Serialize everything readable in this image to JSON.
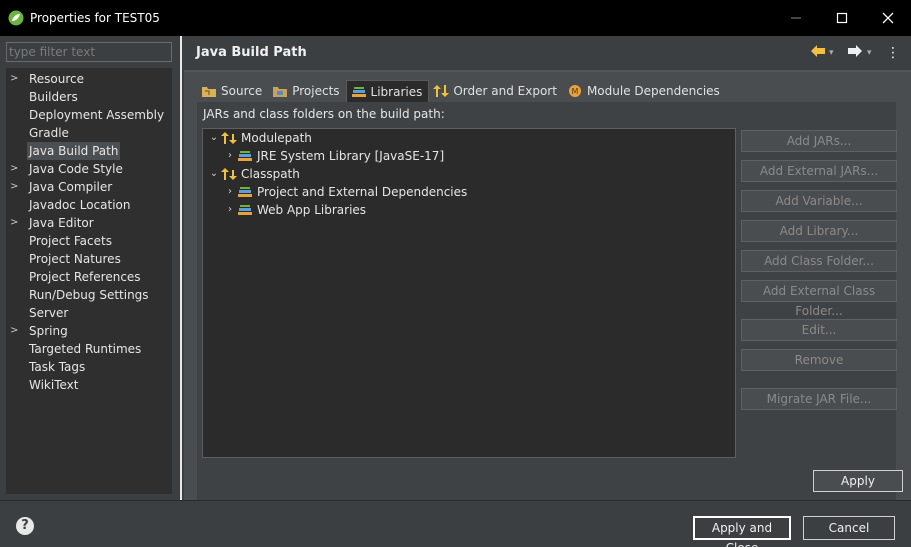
{
  "window": {
    "title": "Properties for TEST05",
    "minimize": "—",
    "maximize": "☐",
    "close": "✕"
  },
  "sidebar": {
    "filter_placeholder": "type filter text",
    "items": [
      {
        "label": "Resource",
        "expandable": true
      },
      {
        "label": "Builders",
        "expandable": false
      },
      {
        "label": "Deployment Assembly",
        "expandable": false
      },
      {
        "label": "Gradle",
        "expandable": false
      },
      {
        "label": "Java Build Path",
        "expandable": false,
        "selected": true
      },
      {
        "label": "Java Code Style",
        "expandable": true
      },
      {
        "label": "Java Compiler",
        "expandable": true
      },
      {
        "label": "Javadoc Location",
        "expandable": false
      },
      {
        "label": "Java Editor",
        "expandable": true
      },
      {
        "label": "Project Facets",
        "expandable": false
      },
      {
        "label": "Project Natures",
        "expandable": false
      },
      {
        "label": "Project References",
        "expandable": false
      },
      {
        "label": "Run/Debug Settings",
        "expandable": false
      },
      {
        "label": "Server",
        "expandable": false
      },
      {
        "label": "Spring",
        "expandable": true
      },
      {
        "label": "Targeted Runtimes",
        "expandable": false
      },
      {
        "label": "Task Tags",
        "expandable": false
      },
      {
        "label": "WikiText",
        "expandable": false
      }
    ]
  },
  "page": {
    "title": "Java Build Path",
    "back": "⇦",
    "forward": "⇨",
    "menu": "⋮",
    "tabs": [
      {
        "label": "Source",
        "icon": "source-folder-icon"
      },
      {
        "label": "Projects",
        "icon": "projects-folder-icon"
      },
      {
        "label": "Libraries",
        "icon": "libraries-icon",
        "active": true
      },
      {
        "label": "Order and Export",
        "icon": "order-export-icon"
      },
      {
        "label": "Module Dependencies",
        "icon": "module-icon"
      }
    ],
    "jars_label": "JARs and class folders on the build path:",
    "tree": [
      {
        "label": "Modulepath",
        "expanded": true,
        "level": 0
      },
      {
        "label": "JRE System Library [JavaSE-17]",
        "expanded": false,
        "level": 1
      },
      {
        "label": "Classpath",
        "expanded": true,
        "level": 0
      },
      {
        "label": "Project and External Dependencies",
        "expanded": false,
        "level": 1
      },
      {
        "label": "Web App Libraries",
        "expanded": false,
        "level": 1
      }
    ],
    "buttons": [
      "Add JARs...",
      "Add External JARs...",
      "Add Variable...",
      "Add Library...",
      "Add Class Folder...",
      "Add External Class Folder...",
      "Edit...",
      "Remove",
      "Migrate JAR File..."
    ],
    "apply": "Apply"
  },
  "footer": {
    "help": "?",
    "apply_close": "Apply and Close",
    "cancel": "Cancel"
  },
  "colors": {
    "titlebar": "#000000",
    "background": "#3c3f41",
    "tree_bg": "#2b2b2b",
    "accent_library": "#e8a23c",
    "disabled_text": "#8a8a8a"
  }
}
